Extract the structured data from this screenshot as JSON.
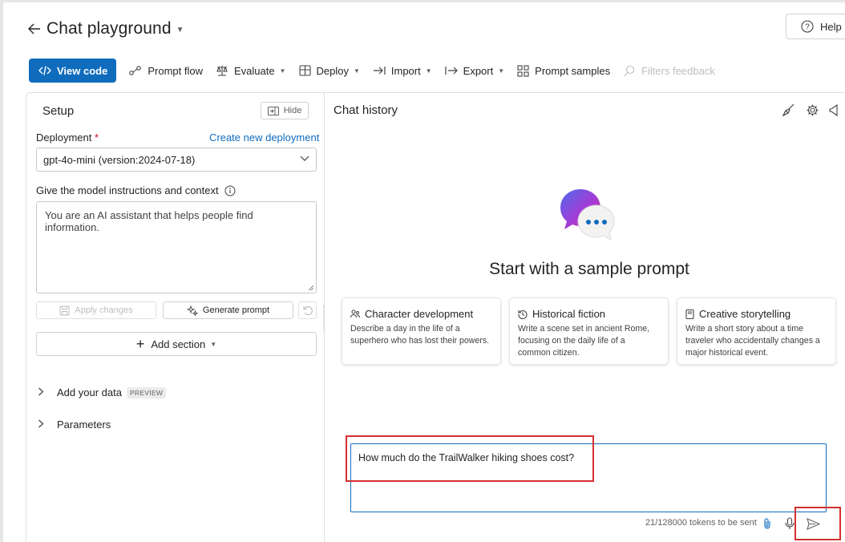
{
  "header": {
    "title": "Chat playground",
    "help_label": "Help"
  },
  "toolbar": {
    "view_code": "View code",
    "prompt_flow": "Prompt flow",
    "evaluate": "Evaluate",
    "deploy": "Deploy",
    "import": "Import",
    "export": "Export",
    "prompt_samples": "Prompt samples",
    "filters_feedback": "Filters feedback"
  },
  "setup": {
    "title": "Setup",
    "hide_label": "Hide",
    "deployment_label": "Deployment",
    "required_mark": "*",
    "create_link": "Create new deployment",
    "deployment_value": "gpt-4o-mini (version:2024-07-18)",
    "instructions_label": "Give the model instructions and context",
    "system_message": "You are an AI assistant that helps people find information.",
    "apply_changes": "Apply changes",
    "generate_prompt": "Generate prompt",
    "add_section": "Add section",
    "add_data": "Add your data",
    "preview_badge": "PREVIEW",
    "parameters": "Parameters"
  },
  "chat": {
    "title": "Chat history",
    "hero_title": "Start with a sample prompt",
    "samples": [
      {
        "title": "Character development",
        "description": "Describe a day in the life of a superhero who has lost their powers."
      },
      {
        "title": "Historical fiction",
        "description": "Write a scene set in ancient Rome, focusing on the daily life of a common citizen."
      },
      {
        "title": "Creative storytelling",
        "description": "Write a short story about a time traveler who accidentally changes a major historical event."
      }
    ],
    "input_value": "How much do the TrailWalker hiking shoes cost?",
    "tokens": "21/128000 tokens to be sent"
  },
  "colors": {
    "accent": "#0f6cbd",
    "highlight": "#d42f2f",
    "required": "#c50f1f"
  }
}
